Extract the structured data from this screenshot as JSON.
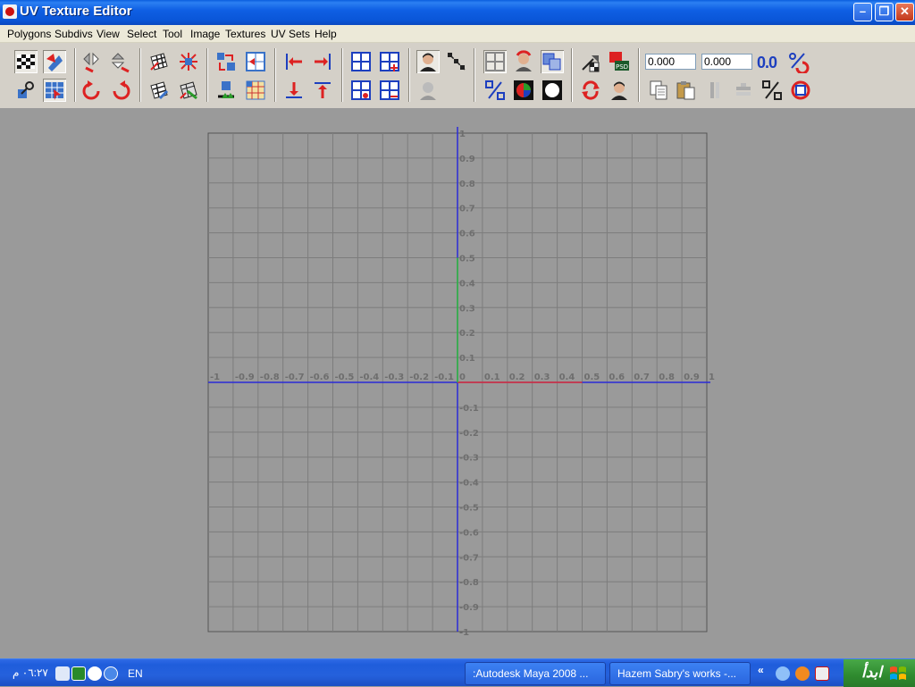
{
  "window": {
    "title": "UV Texture Editor"
  },
  "menu": [
    "Polygons",
    "Subdivs",
    "View",
    "Select",
    "Tool",
    "Image",
    "Textures",
    "UV Sets",
    "Help"
  ],
  "toolbar": {
    "u_value": "0.000",
    "v_value": "0.000",
    "precision_label": "0.0"
  },
  "grid": {
    "x_labels": [
      "-1",
      "-0.9",
      "-0.8",
      "-0.7",
      "-0.6",
      "-0.5",
      "-0.4",
      "-0.3",
      "-0.2",
      "-0.1",
      "0",
      "0.1",
      "0.2",
      "0.3",
      "0.4",
      "0.5",
      "0.6",
      "0.7",
      "0.8",
      "0.9",
      "1"
    ],
    "y_labels": [
      "1",
      "0.9",
      "0.8",
      "0.7",
      "0.6",
      "0.5",
      "0.4",
      "0.3",
      "0.2",
      "0.1",
      "-0.1",
      "-0.2",
      "-0.3",
      "-0.4",
      "-0.5",
      "-0.6",
      "-0.7",
      "-0.8",
      "-0.9",
      "-1"
    ],
    "y_values": [
      1,
      0.9,
      0.8,
      0.7,
      0.6,
      0.5,
      0.4,
      0.3,
      0.2,
      0.1,
      -0.1,
      -0.2,
      -0.3,
      -0.4,
      -0.5,
      -0.6,
      -0.7,
      -0.8,
      -0.9,
      -1
    ],
    "colors": {
      "axis": "#2b2bd8",
      "u_axis": "#e03333",
      "v_axis": "#33c133",
      "line": "#7d7d7d",
      "label": "#6e6e6e"
    }
  },
  "taskbar": {
    "clock": "٠٦:٢٧ م",
    "language": "EN",
    "tasks": [
      ":Autodesk Maya 2008 ...",
      "Hazem Sabry's works -..."
    ],
    "start_label": "ابدأ"
  }
}
